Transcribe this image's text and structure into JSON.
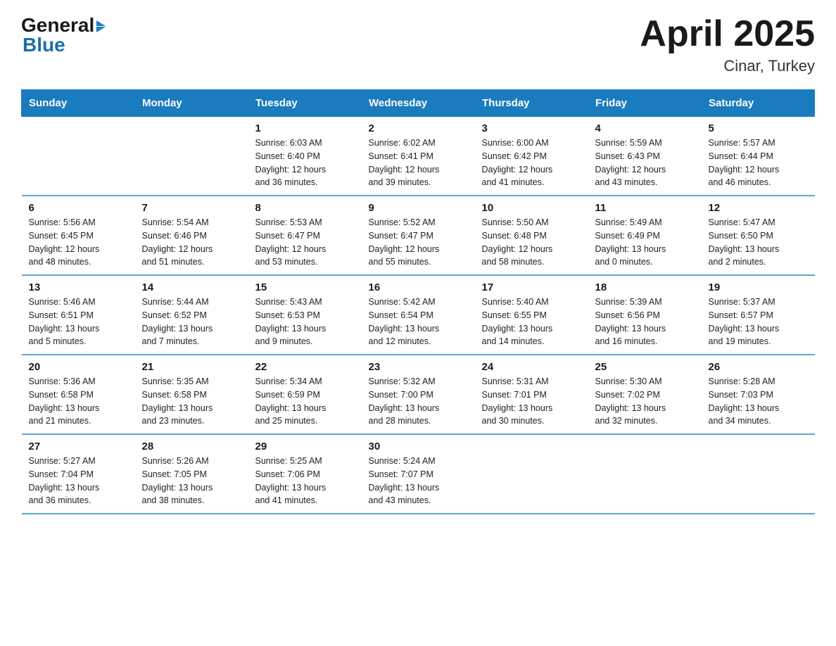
{
  "logo": {
    "general": "General",
    "blue": "Blue"
  },
  "title": {
    "month": "April 2025",
    "location": "Cinar, Turkey"
  },
  "days_header": [
    "Sunday",
    "Monday",
    "Tuesday",
    "Wednesday",
    "Thursday",
    "Friday",
    "Saturday"
  ],
  "weeks": [
    [
      {
        "day": "",
        "info": ""
      },
      {
        "day": "",
        "info": ""
      },
      {
        "day": "1",
        "info": "Sunrise: 6:03 AM\nSunset: 6:40 PM\nDaylight: 12 hours\nand 36 minutes."
      },
      {
        "day": "2",
        "info": "Sunrise: 6:02 AM\nSunset: 6:41 PM\nDaylight: 12 hours\nand 39 minutes."
      },
      {
        "day": "3",
        "info": "Sunrise: 6:00 AM\nSunset: 6:42 PM\nDaylight: 12 hours\nand 41 minutes."
      },
      {
        "day": "4",
        "info": "Sunrise: 5:59 AM\nSunset: 6:43 PM\nDaylight: 12 hours\nand 43 minutes."
      },
      {
        "day": "5",
        "info": "Sunrise: 5:57 AM\nSunset: 6:44 PM\nDaylight: 12 hours\nand 46 minutes."
      }
    ],
    [
      {
        "day": "6",
        "info": "Sunrise: 5:56 AM\nSunset: 6:45 PM\nDaylight: 12 hours\nand 48 minutes."
      },
      {
        "day": "7",
        "info": "Sunrise: 5:54 AM\nSunset: 6:46 PM\nDaylight: 12 hours\nand 51 minutes."
      },
      {
        "day": "8",
        "info": "Sunrise: 5:53 AM\nSunset: 6:47 PM\nDaylight: 12 hours\nand 53 minutes."
      },
      {
        "day": "9",
        "info": "Sunrise: 5:52 AM\nSunset: 6:47 PM\nDaylight: 12 hours\nand 55 minutes."
      },
      {
        "day": "10",
        "info": "Sunrise: 5:50 AM\nSunset: 6:48 PM\nDaylight: 12 hours\nand 58 minutes."
      },
      {
        "day": "11",
        "info": "Sunrise: 5:49 AM\nSunset: 6:49 PM\nDaylight: 13 hours\nand 0 minutes."
      },
      {
        "day": "12",
        "info": "Sunrise: 5:47 AM\nSunset: 6:50 PM\nDaylight: 13 hours\nand 2 minutes."
      }
    ],
    [
      {
        "day": "13",
        "info": "Sunrise: 5:46 AM\nSunset: 6:51 PM\nDaylight: 13 hours\nand 5 minutes."
      },
      {
        "day": "14",
        "info": "Sunrise: 5:44 AM\nSunset: 6:52 PM\nDaylight: 13 hours\nand 7 minutes."
      },
      {
        "day": "15",
        "info": "Sunrise: 5:43 AM\nSunset: 6:53 PM\nDaylight: 13 hours\nand 9 minutes."
      },
      {
        "day": "16",
        "info": "Sunrise: 5:42 AM\nSunset: 6:54 PM\nDaylight: 13 hours\nand 12 minutes."
      },
      {
        "day": "17",
        "info": "Sunrise: 5:40 AM\nSunset: 6:55 PM\nDaylight: 13 hours\nand 14 minutes."
      },
      {
        "day": "18",
        "info": "Sunrise: 5:39 AM\nSunset: 6:56 PM\nDaylight: 13 hours\nand 16 minutes."
      },
      {
        "day": "19",
        "info": "Sunrise: 5:37 AM\nSunset: 6:57 PM\nDaylight: 13 hours\nand 19 minutes."
      }
    ],
    [
      {
        "day": "20",
        "info": "Sunrise: 5:36 AM\nSunset: 6:58 PM\nDaylight: 13 hours\nand 21 minutes."
      },
      {
        "day": "21",
        "info": "Sunrise: 5:35 AM\nSunset: 6:58 PM\nDaylight: 13 hours\nand 23 minutes."
      },
      {
        "day": "22",
        "info": "Sunrise: 5:34 AM\nSunset: 6:59 PM\nDaylight: 13 hours\nand 25 minutes."
      },
      {
        "day": "23",
        "info": "Sunrise: 5:32 AM\nSunset: 7:00 PM\nDaylight: 13 hours\nand 28 minutes."
      },
      {
        "day": "24",
        "info": "Sunrise: 5:31 AM\nSunset: 7:01 PM\nDaylight: 13 hours\nand 30 minutes."
      },
      {
        "day": "25",
        "info": "Sunrise: 5:30 AM\nSunset: 7:02 PM\nDaylight: 13 hours\nand 32 minutes."
      },
      {
        "day": "26",
        "info": "Sunrise: 5:28 AM\nSunset: 7:03 PM\nDaylight: 13 hours\nand 34 minutes."
      }
    ],
    [
      {
        "day": "27",
        "info": "Sunrise: 5:27 AM\nSunset: 7:04 PM\nDaylight: 13 hours\nand 36 minutes."
      },
      {
        "day": "28",
        "info": "Sunrise: 5:26 AM\nSunset: 7:05 PM\nDaylight: 13 hours\nand 38 minutes."
      },
      {
        "day": "29",
        "info": "Sunrise: 5:25 AM\nSunset: 7:06 PM\nDaylight: 13 hours\nand 41 minutes."
      },
      {
        "day": "30",
        "info": "Sunrise: 5:24 AM\nSunset: 7:07 PM\nDaylight: 13 hours\nand 43 minutes."
      },
      {
        "day": "",
        "info": ""
      },
      {
        "day": "",
        "info": ""
      },
      {
        "day": "",
        "info": ""
      }
    ]
  ]
}
